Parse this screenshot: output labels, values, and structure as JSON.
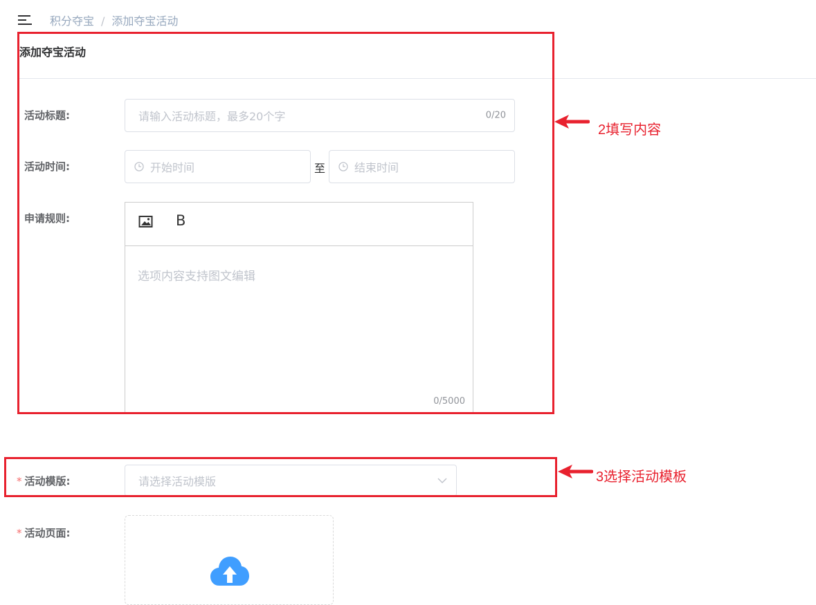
{
  "breadcrumb": {
    "parent": "积分夺宝",
    "separator": "/",
    "current": "添加夺宝活动"
  },
  "card": {
    "title": "添加夺宝活动"
  },
  "form": {
    "title_field": {
      "label": "活动标题:",
      "placeholder": "请输入活动标题，最多20个字",
      "counter": "0/20"
    },
    "time_field": {
      "label": "活动时间:",
      "start_placeholder": "开始时间",
      "separator": "至",
      "end_placeholder": "结束时间"
    },
    "rules_field": {
      "label": "申请规则:",
      "placeholder": "选项内容支持图文编辑",
      "counter": "0/5000",
      "bold_button": "B"
    },
    "template_field": {
      "required_mark": "*",
      "label": "活动模版:",
      "placeholder": "请选择活动模版"
    },
    "page_field": {
      "required_mark": "*",
      "label": "活动页面:"
    }
  },
  "annotations": {
    "note_2": "2填写内容",
    "note_3": "3选择活动模板",
    "color": "#e8212e"
  },
  "icons": {
    "menu": "hamburger-icon",
    "clock": "clock-icon",
    "image": "image-icon",
    "chevron": "chevron-down-icon",
    "upload": "cloud-upload-icon"
  },
  "colors": {
    "upload_icon": "#409eff",
    "required": "#f56c6c"
  }
}
